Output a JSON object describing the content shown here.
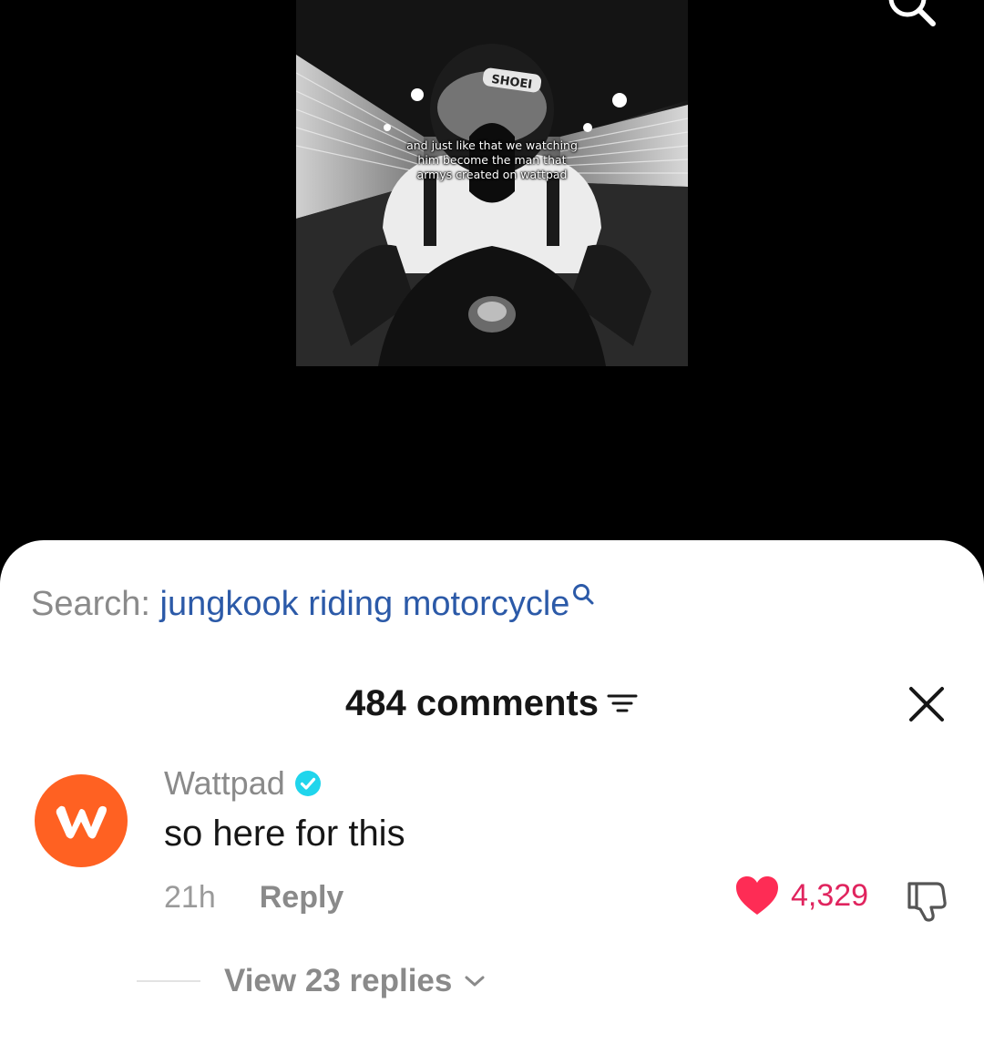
{
  "video": {
    "caption": "and just like that we watching him become the man that armys created on wattpad",
    "helmet_brand": "SHOEI"
  },
  "search": {
    "prefix": "Search: ",
    "query": "jungkook riding motorcycle"
  },
  "comments": {
    "header": "484 comments",
    "items": [
      {
        "username": "Wattpad",
        "verified": true,
        "text": "so here for this",
        "timestamp": "21h",
        "reply_label": "Reply",
        "likes": "4,329",
        "view_replies": "View 23 replies"
      }
    ]
  },
  "colors": {
    "link_blue": "#2c5aa8",
    "like_red": "#fe2c55",
    "avatar_orange": "#ff6122",
    "verified_cyan": "#20d5ec"
  },
  "icons": {
    "top_search": "search-icon",
    "search_query": "search-icon",
    "filter": "filter-icon",
    "close": "close-icon",
    "verified": "verified-badge-icon",
    "like": "heart-icon",
    "dislike": "thumbs-down-icon",
    "expand": "chevron-down-icon"
  }
}
